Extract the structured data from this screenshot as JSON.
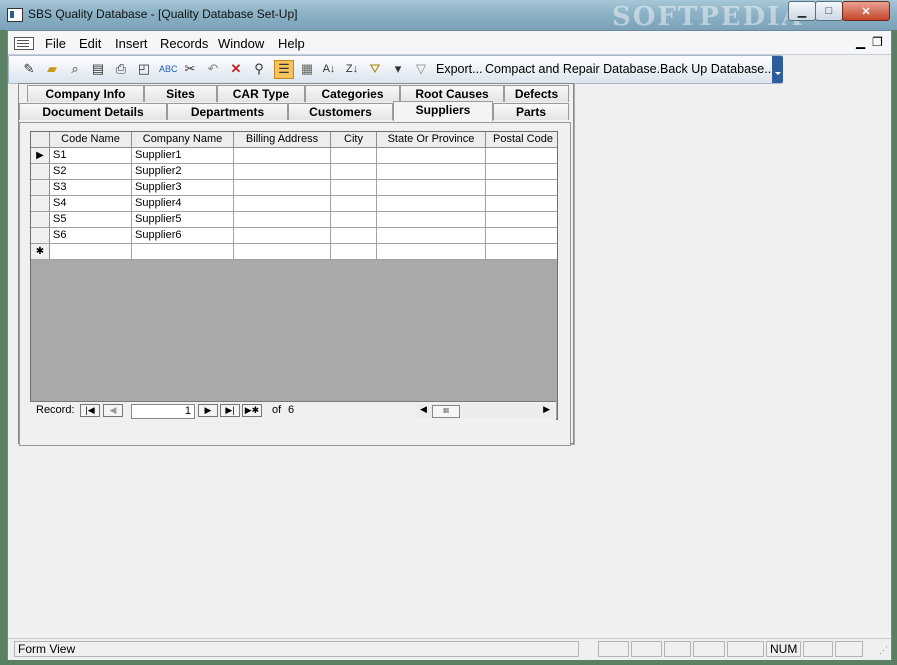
{
  "window": {
    "title": "SBS Quality Database - [Quality Database Set-Up]",
    "watermark": "SOFTPEDIA",
    "controls": {
      "minimize": "▁",
      "maximize": "□",
      "close": "✕",
      "doc_minimize": "▁",
      "doc_restore": "❐"
    }
  },
  "menu": [
    "File",
    "Edit",
    "Insert",
    "Records",
    "Window",
    "Help"
  ],
  "toolbar": {
    "icons": [
      "design-icon",
      "open-icon",
      "search-object-icon",
      "properties-icon",
      "print-icon",
      "print-preview-icon",
      "spelling-icon",
      "cut-icon",
      "paste-icon",
      "undo-icon",
      "delete-icon",
      "find-icon",
      "form-view-icon",
      "datasheet-icon",
      "sort-ascending-icon",
      "sort-descending-icon",
      "filter-by-selection-icon",
      "filter-by-form-icon",
      "apply-filter-icon"
    ],
    "buttons": [
      "Export...",
      "Compact and Repair Database...",
      "Back Up Database..."
    ]
  },
  "tabs": {
    "row1": [
      "Company Info",
      "Sites",
      "CAR Type",
      "Categories",
      "Root Causes",
      "Defects"
    ],
    "row2": [
      "Document Details",
      "Departments",
      "Customers",
      "Suppliers",
      "Parts"
    ],
    "selected": "Suppliers"
  },
  "grid": {
    "columns": [
      "Code Name",
      "Company Name",
      "Billing Address",
      "City",
      "State Or Province",
      "Postal Code"
    ],
    "rows": [
      [
        "S1",
        "Supplier1",
        "",
        "",
        "",
        ""
      ],
      [
        "S2",
        "Supplier2",
        "",
        "",
        "",
        ""
      ],
      [
        "S3",
        "Supplier3",
        "",
        "",
        "",
        ""
      ],
      [
        "S4",
        "Supplier4",
        "",
        "",
        "",
        ""
      ],
      [
        "S5",
        "Supplier5",
        "",
        "",
        "",
        ""
      ],
      [
        "S6",
        "Supplier6",
        "",
        "",
        "",
        ""
      ]
    ],
    "current_row_marker": "▶",
    "new_row_marker": "✱"
  },
  "navigator": {
    "label": "Record:",
    "current": "1",
    "of_label": "of",
    "total": "6",
    "first": "|◀",
    "prev": "◀",
    "next": "▶",
    "last": "▶|",
    "new": "▶✱"
  },
  "status": {
    "mode": "Form View",
    "num": "NUM"
  },
  "colors": {
    "title_gradient": "#8fb4c7",
    "desktop": "#5a7f62",
    "grid_bg": "#a9a9a9",
    "active_icon": "#f7c35c"
  }
}
